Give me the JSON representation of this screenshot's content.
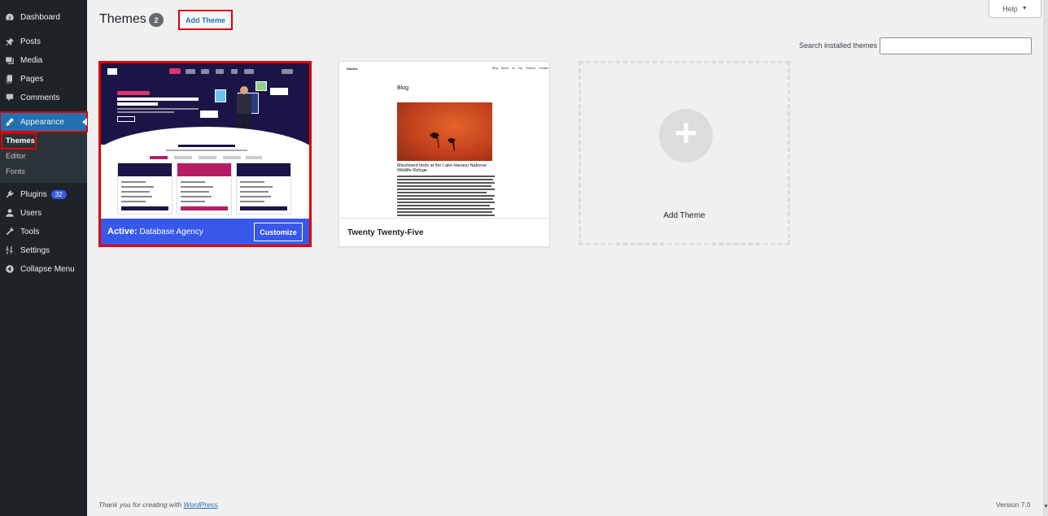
{
  "sidebar": {
    "items": [
      {
        "label": "Dashboard",
        "icon": "dashboard-icon"
      },
      {
        "label": "Posts",
        "icon": "pin-icon"
      },
      {
        "label": "Media",
        "icon": "media-icon"
      },
      {
        "label": "Pages",
        "icon": "pages-icon"
      },
      {
        "label": "Comments",
        "icon": "comment-icon"
      },
      {
        "label": "Appearance",
        "icon": "brush-icon"
      },
      {
        "label": "Plugins",
        "icon": "plugin-icon",
        "badge": "32"
      },
      {
        "label": "Users",
        "icon": "users-icon"
      },
      {
        "label": "Tools",
        "icon": "wrench-icon"
      },
      {
        "label": "Settings",
        "icon": "settings-icon"
      },
      {
        "label": "Collapse Menu",
        "icon": "collapse-icon"
      }
    ],
    "appearance_submenu": [
      "Themes",
      "Editor",
      "Fonts"
    ]
  },
  "header": {
    "title": "Themes",
    "count": "2",
    "add_theme_label": "Add Theme",
    "help_label": "Help",
    "search_label": "Search installed themes"
  },
  "themes": {
    "active": {
      "prefix": "Active:",
      "name": "Database Agency",
      "customize_label": "Customize"
    },
    "second": {
      "name": "Twenty Twenty-Five",
      "preview_brand": "Stories",
      "preview_nav": "Blog About us Top Feature Contact",
      "preview_heading": "Blog",
      "preview_post_title": "Marshland birds at the Lake Havasu National Wildlife Refuge"
    },
    "add_card_label": "Add Theme"
  },
  "footer": {
    "thanks_prefix": "Thank you for creating with",
    "link": "WordPress",
    "suffix": ".",
    "version": "Version 7.0"
  },
  "colors": {
    "sidebar_bg": "#1d2327",
    "active_blue": "#2271b1",
    "active_theme_bar": "#3858e9",
    "highlight_red": "#e00000"
  }
}
